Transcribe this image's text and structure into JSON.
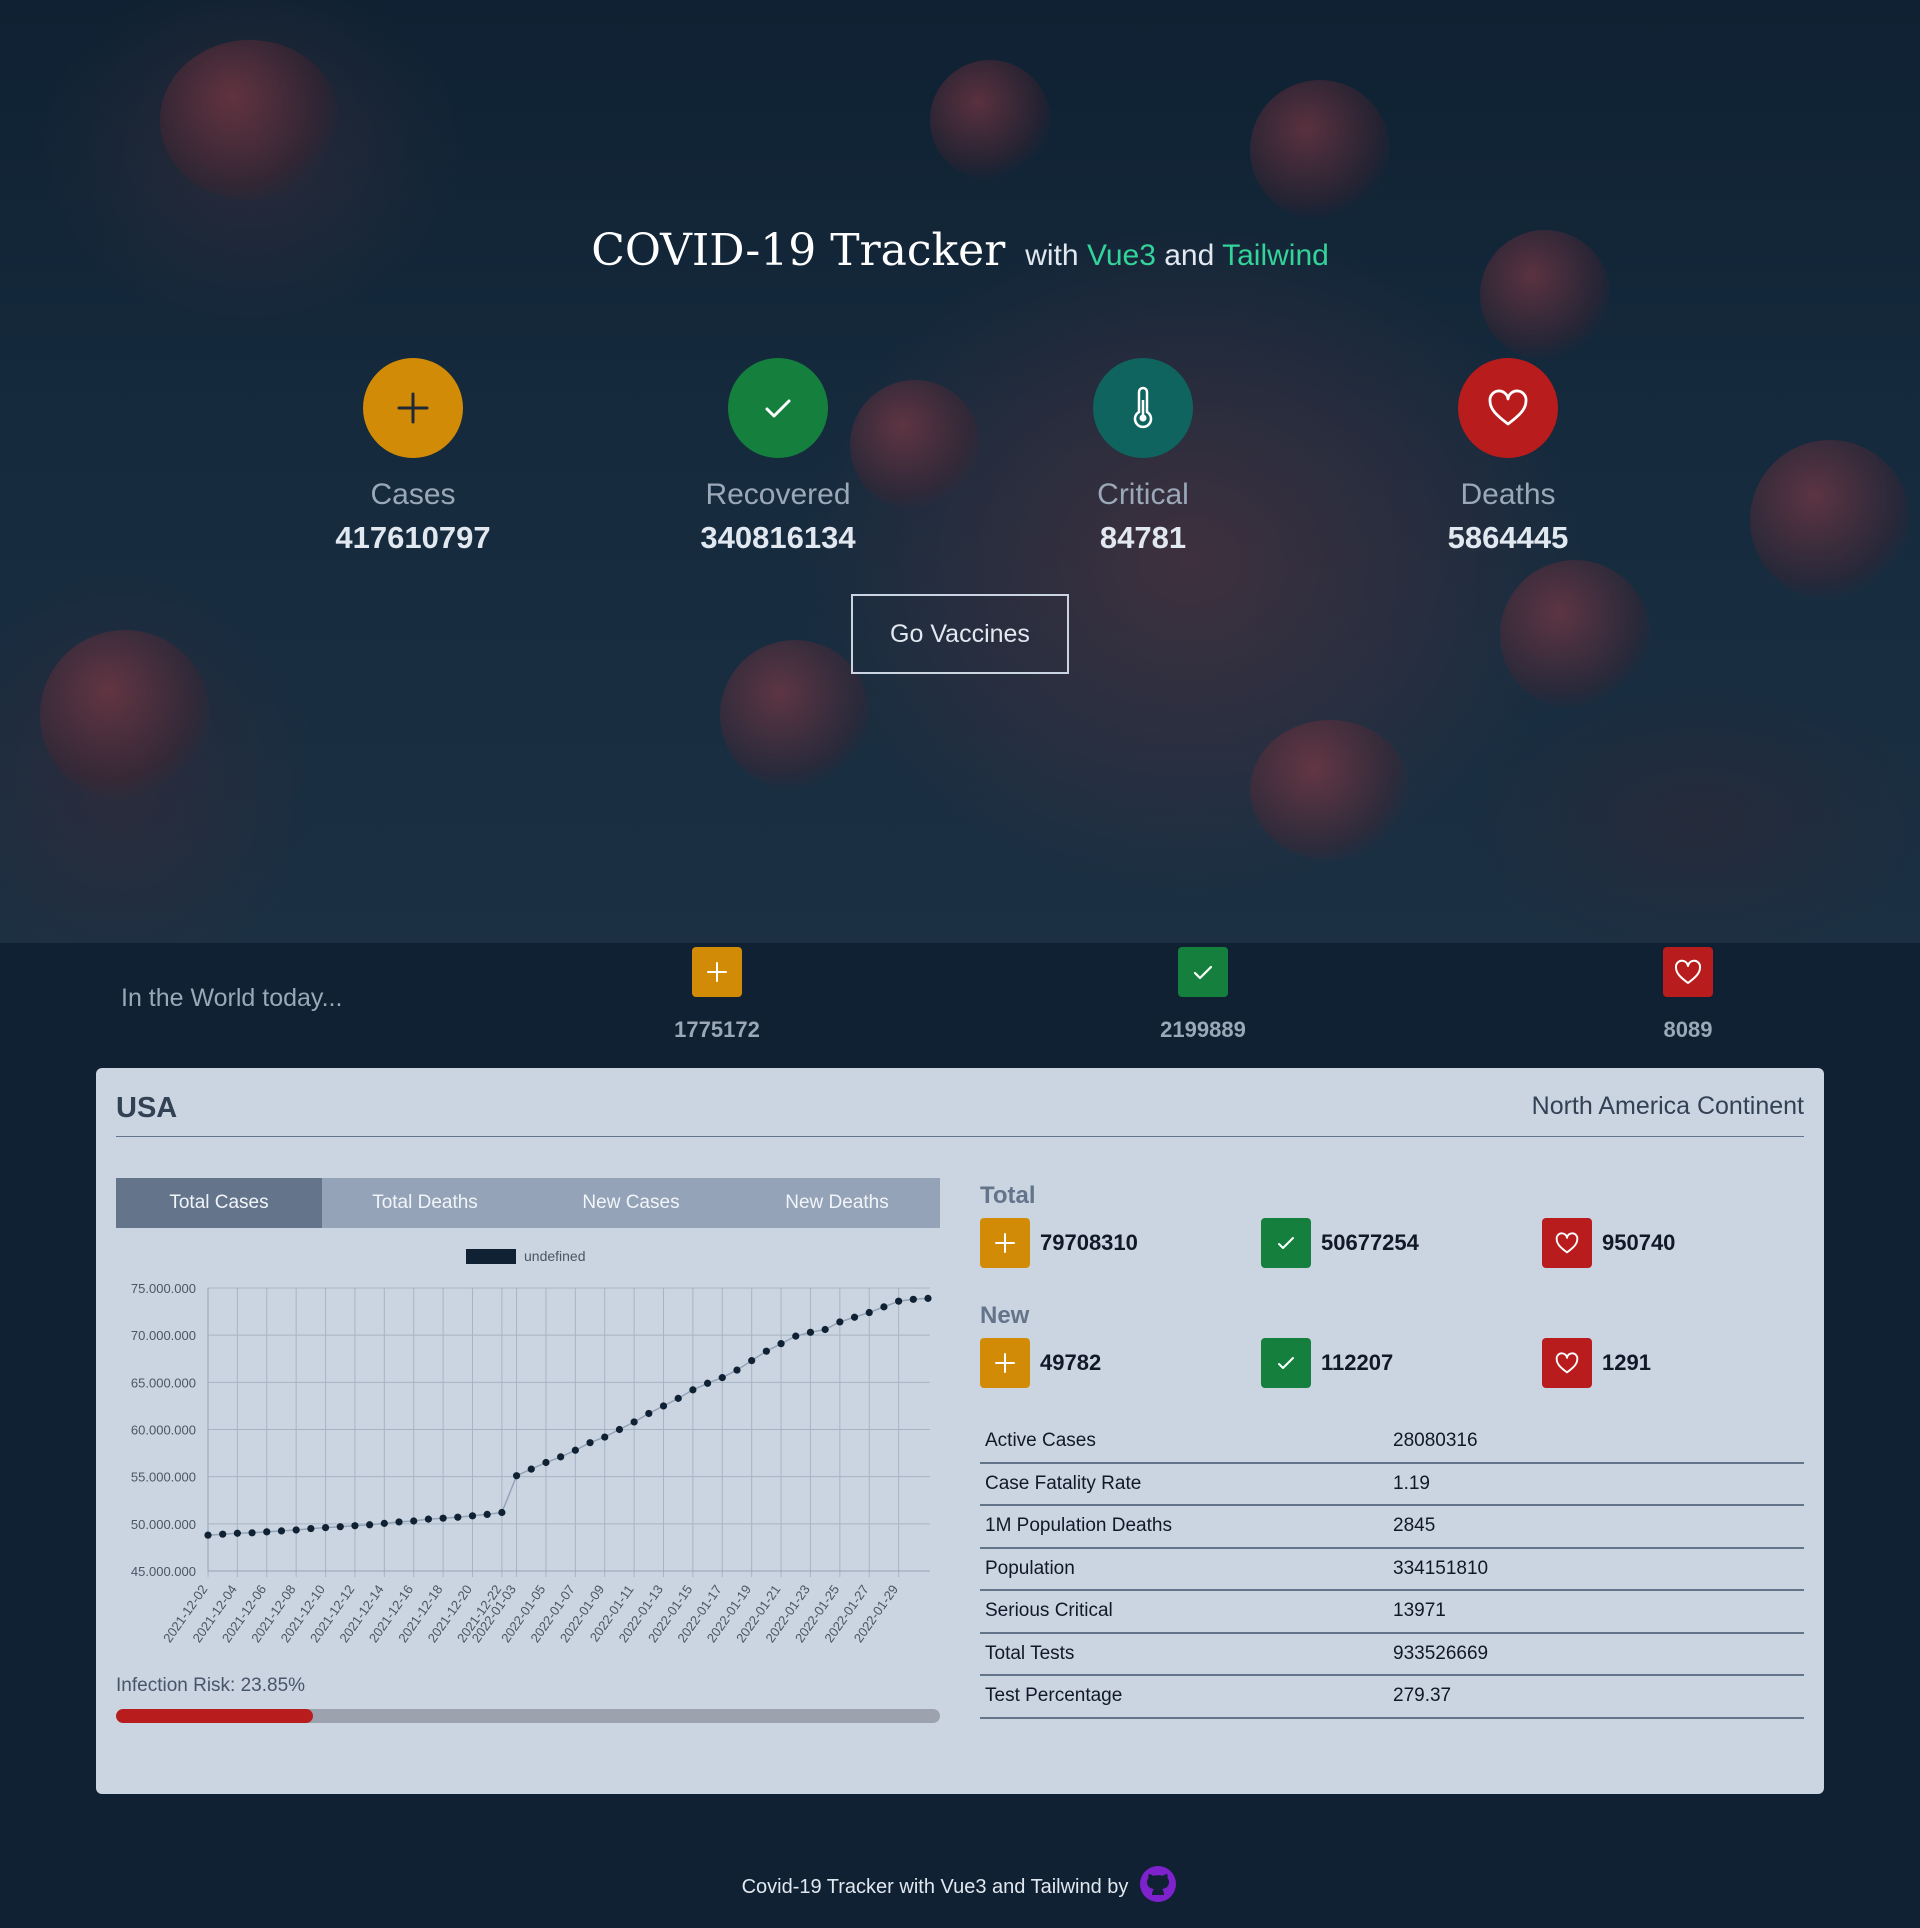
{
  "header": {
    "title": "COVID-19 Tracker",
    "with_word": "with",
    "framework1": "Vue3",
    "and_word": "and",
    "framework2": "Tailwind"
  },
  "global_stats": [
    {
      "label": "Cases",
      "value": "417610797",
      "icon": "plus-icon",
      "color": "#d18b06"
    },
    {
      "label": "Recovered",
      "value": "340816134",
      "icon": "check-icon",
      "color": "#15803d"
    },
    {
      "label": "Critical",
      "value": "84781",
      "icon": "thermometer-icon",
      "color": "#0f6460"
    },
    {
      "label": "Deaths",
      "value": "5864445",
      "icon": "heart-icon",
      "color": "#b91c1c"
    }
  ],
  "vaccines_button": "Go Vaccines",
  "world_today": {
    "label": "In the World today...",
    "cases": "1775172",
    "recovered": "2199889",
    "deaths": "8089"
  },
  "country_panel": {
    "country": "USA",
    "continent": "North America Continent",
    "tabs": [
      "Total Cases",
      "Total Deaths",
      "New Cases",
      "New Deaths"
    ],
    "active_tab": "Total Cases",
    "infection_risk_label": "Infection Risk: 23.85%",
    "infection_risk": 23.85,
    "total_title": "Total",
    "total": {
      "cases": "79708310",
      "recovered": "50677254",
      "deaths": "950740"
    },
    "new_title": "New",
    "new": {
      "cases": "49782",
      "recovered": "112207",
      "deaths": "1291"
    },
    "details": [
      {
        "key": "Active Cases",
        "value": "28080316"
      },
      {
        "key": "Case Fatality Rate",
        "value": "1.19"
      },
      {
        "key": "1M Population Deaths",
        "value": "2845"
      },
      {
        "key": "Population",
        "value": "334151810"
      },
      {
        "key": "Serious Critical",
        "value": "13971"
      },
      {
        "key": "Total Tests",
        "value": "933526669"
      },
      {
        "key": "Test Percentage",
        "value": "279.37"
      }
    ]
  },
  "chart_data": {
    "type": "line",
    "legend": "undefined",
    "series_color": "#0f2132",
    "ylim": [
      45000000,
      75000000
    ],
    "y_ticks": [
      "45.000.000",
      "50.000.000",
      "55.000.000",
      "60.000.000",
      "65.000.000",
      "70.000.000",
      "75.000.000"
    ],
    "x_tick_labels": [
      "2021-12-02",
      "2021-12-04",
      "2021-12-06",
      "2021-12-08",
      "2021-12-10",
      "2021-12-12",
      "2021-12-14",
      "2021-12-16",
      "2021-12-18",
      "2021-12-20",
      "2021-12-22",
      "2022-01-03",
      "2022-01-05",
      "2022-01-07",
      "2022-01-09",
      "2022-01-11",
      "2022-01-13",
      "2022-01-15",
      "2022-01-17",
      "2022-01-19",
      "2022-01-21",
      "2022-01-23",
      "2022-01-25",
      "2022-01-27",
      "2022-01-29"
    ],
    "x": [
      "2021-12-02",
      "2021-12-03",
      "2021-12-04",
      "2021-12-05",
      "2021-12-06",
      "2021-12-07",
      "2021-12-08",
      "2021-12-09",
      "2021-12-10",
      "2021-12-11",
      "2021-12-12",
      "2021-12-13",
      "2021-12-14",
      "2021-12-15",
      "2021-12-16",
      "2021-12-17",
      "2021-12-18",
      "2021-12-19",
      "2021-12-20",
      "2021-12-21",
      "2021-12-22",
      "2022-01-03",
      "2022-01-04",
      "2022-01-05",
      "2022-01-06",
      "2022-01-07",
      "2022-01-08",
      "2022-01-09",
      "2022-01-10",
      "2022-01-11",
      "2022-01-12",
      "2022-01-13",
      "2022-01-14",
      "2022-01-15",
      "2022-01-16",
      "2022-01-17",
      "2022-01-18",
      "2022-01-19",
      "2022-01-20",
      "2022-01-21",
      "2022-01-22",
      "2022-01-23",
      "2022-01-24",
      "2022-01-25",
      "2022-01-26",
      "2022-01-27",
      "2022-01-28",
      "2022-01-29",
      "2022-01-30",
      "2022-01-31"
    ],
    "values": [
      48800000,
      48900000,
      49000000,
      49050000,
      49150000,
      49250000,
      49350000,
      49500000,
      49600000,
      49700000,
      49800000,
      49900000,
      50050000,
      50200000,
      50300000,
      50500000,
      50600000,
      50700000,
      50850000,
      51000000,
      51200000,
      55100000,
      55800000,
      56500000,
      57100000,
      57800000,
      58600000,
      59200000,
      60000000,
      60800000,
      61700000,
      62500000,
      63300000,
      64200000,
      64900000,
      65500000,
      66300000,
      67300000,
      68300000,
      69100000,
      69900000,
      70300000,
      70600000,
      71400000,
      71900000,
      72400000,
      73000000,
      73600000,
      73800000,
      73900000
    ]
  },
  "footer": {
    "text": "Covid-19 Tracker with Vue3 and Tailwind by"
  }
}
